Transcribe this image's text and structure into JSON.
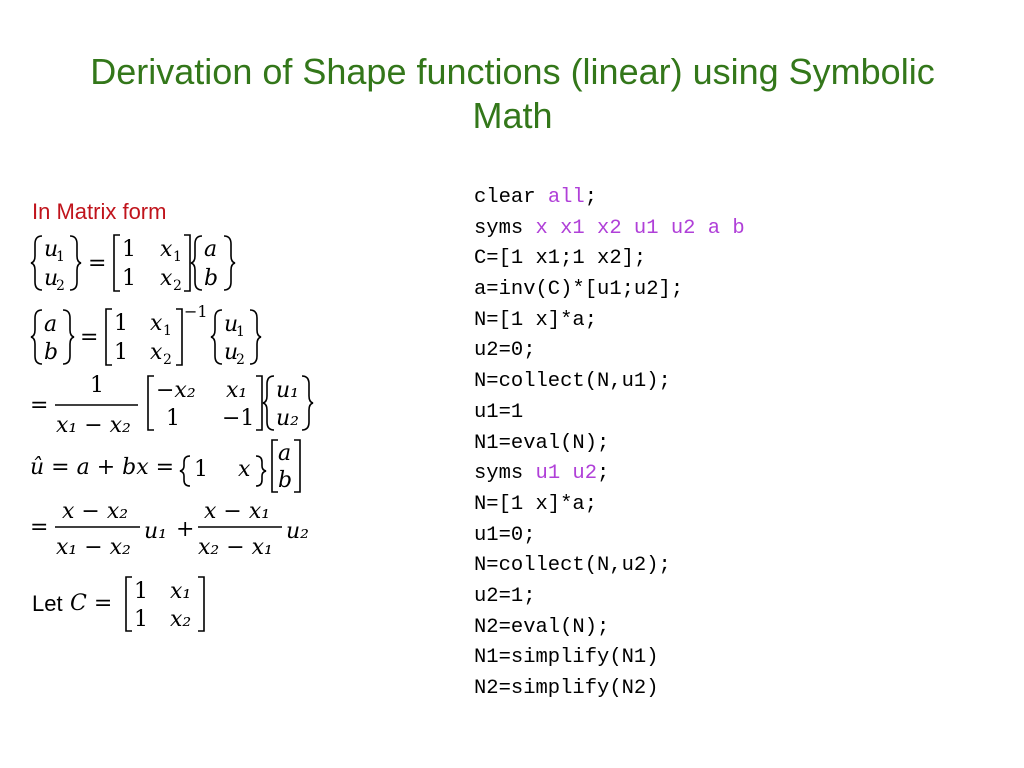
{
  "slide": {
    "title": "Derivation of Shape functions (linear) using Symbolic Math",
    "title_color": "#33771a",
    "subhead": "In Matrix form",
    "subhead_color": "#c0141c",
    "let_label": "Let",
    "code_keyword_color": "#b040d8"
  },
  "code": {
    "lines": [
      {
        "plain": "clear ",
        "kw": "all",
        "tail": ";"
      },
      {
        "plain": "syms ",
        "kw": "x x1 x2 u1 u2 a b",
        "tail": ""
      },
      {
        "plain": "C=[1 x1;1 x2];",
        "kw": "",
        "tail": ""
      },
      {
        "plain": "a=inv(C)*[u1;u2];",
        "kw": "",
        "tail": ""
      },
      {
        "plain": "N=[1 x]*a;",
        "kw": "",
        "tail": ""
      },
      {
        "plain": "u2=0;",
        "kw": "",
        "tail": ""
      },
      {
        "plain": "N=collect(N,u1);",
        "kw": "",
        "tail": ""
      },
      {
        "plain": "u1=1",
        "kw": "",
        "tail": ""
      },
      {
        "plain": "N1=eval(N);",
        "kw": "",
        "tail": ""
      },
      {
        "plain": "syms ",
        "kw": "u1 u2",
        "tail": ";"
      },
      {
        "plain": "N=[1 x]*a;",
        "kw": "",
        "tail": ""
      },
      {
        "plain": "u1=0;",
        "kw": "",
        "tail": ""
      },
      {
        "plain": "N=collect(N,u2);",
        "kw": "",
        "tail": ""
      },
      {
        "plain": "u2=1;",
        "kw": "",
        "tail": ""
      },
      {
        "plain": "N2=eval(N);",
        "kw": "",
        "tail": ""
      },
      {
        "plain": "N1=simplify(N1)",
        "kw": "",
        "tail": ""
      },
      {
        "plain": "N2=simplify(N2)",
        "kw": "",
        "tail": ""
      }
    ]
  },
  "equations": {
    "eq1": {
      "u1": "u",
      "s1": "1",
      "u2": "u",
      "s2": "2",
      "eq": "=",
      "m11": "1",
      "m12": "x",
      "m12s": "1",
      "m21": "1",
      "m22": "x",
      "m22s": "2",
      "v1": "a",
      "v2": "b"
    },
    "eq2": {
      "v1": "a",
      "v2": "b",
      "eq": "=",
      "m11": "1",
      "m12": "x",
      "m12s": "1",
      "m21": "1",
      "m22": "x",
      "m22s": "2",
      "exp": "−1",
      "u1": "u",
      "s1": "1",
      "u2": "u",
      "s2": "2"
    },
    "eq3": {
      "eq": "=",
      "num": "1",
      "den": "x₁ − x₂",
      "m11": "−x₂",
      "m12": "x₁",
      "m21": "1",
      "m22": "−1",
      "u1": "u₁",
      "u2": "u₂"
    },
    "eq4": {
      "lhs": "û = a + bx =",
      "r1": "1",
      "r2": "x",
      "v1": "a",
      "v2": "b"
    },
    "eq5": {
      "eq": "=",
      "n1": "x − x₂",
      "d1": "x₁ − x₂",
      "t1": "u₁",
      "plus": "+",
      "n2": "x − x₁",
      "d2": "x₂ − x₁",
      "t2": "u₂"
    },
    "eq6": {
      "lhs": "C =",
      "m11": "1",
      "m12": "x₁",
      "m21": "1",
      "m22": "x₂"
    }
  }
}
